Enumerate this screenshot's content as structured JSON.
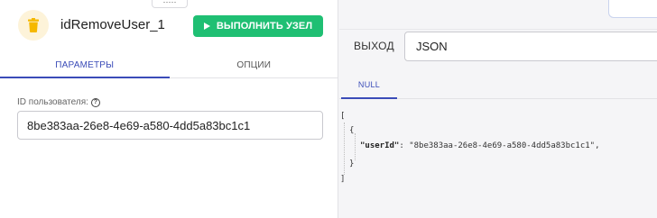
{
  "node": {
    "title": "idRemoveUser_1",
    "icon": "trash-icon",
    "icon_color": "#f5b800",
    "execute_label": "ВЫПОЛНИТЬ УЗЕЛ",
    "execute_color": "#1fbf73"
  },
  "drag_handle_text": "·····",
  "tabs": {
    "parameters": "ПАРАМЕТРЫ",
    "options": "ОПЦИИ",
    "active": "parameters",
    "accent_color": "#3b4cb8"
  },
  "params": {
    "user_id_label": "ID пользователя:",
    "user_id_value": "8be383aa-26e8-4e69-a580-4dd5a83bc1c1"
  },
  "output": {
    "label": "ВЫХОД",
    "format": "JSON",
    "tab": "NULL"
  },
  "json_output": {
    "open_bracket": "[",
    "open_brace": "{",
    "key": "\"userId\"",
    "colon": ": ",
    "value": "\"8be383aa-26e8-4e69-a580-4dd5a83bc1c1\"",
    "comma": ",",
    "close_brace": "}",
    "close_bracket": "]"
  }
}
